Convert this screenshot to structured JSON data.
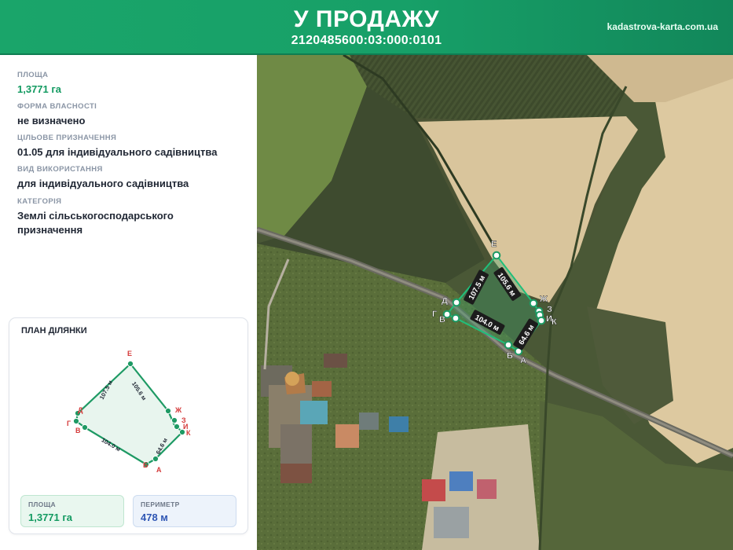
{
  "header": {
    "title": "У ПРОДАЖУ",
    "cadastral_number": "2120485600:03:000:0101",
    "site": "kadastrova-karta.com.ua"
  },
  "info": {
    "area_label": "ПЛОЩА",
    "area_value": "1,3771 га",
    "ownership_label": "ФОРМА ВЛАСНОСТІ",
    "ownership_value": "не визначено",
    "purpose_label": "ЦІЛЬОВЕ ПРИЗНАЧЕННЯ",
    "purpose_value": "01.05 для індивідуального садівництва",
    "usage_label": "ВИД ВИКОРИСТАННЯ",
    "usage_value": "для індивідуального садівництва",
    "category_label": "КАТЕГОРІЯ",
    "category_value_line1": "Землі сільськогосподарського",
    "category_value_line2": "призначення"
  },
  "plan": {
    "title": "ПЛАН ДІЛЯНКИ",
    "vertex_labels": [
      "А",
      "Б",
      "В",
      "Г",
      "Д",
      "Е",
      "Ж",
      "З",
      "И",
      "К"
    ],
    "side_lengths": [
      "107.5 м",
      "105.6 м",
      "104.0 м",
      "64.6 м"
    ],
    "area_label": "ПЛОЩА",
    "area_value": "1,3771 га",
    "perimeter_label": "ПЕРИМЕТР",
    "perimeter_value": "478 м"
  },
  "map": {
    "vertex_labels": [
      "А",
      "Б",
      "В",
      "Г",
      "Д",
      "Е",
      "Ж",
      "З",
      "И",
      "К"
    ],
    "side_lengths": [
      "107.5 м",
      "105.6 м",
      "104.0 м",
      "64.6 м"
    ]
  },
  "colors": {
    "header": "#17a068",
    "accent_green": "#139a61",
    "vertex_red": "#d43a3a",
    "perimeter_blue": "#2f56b4"
  }
}
